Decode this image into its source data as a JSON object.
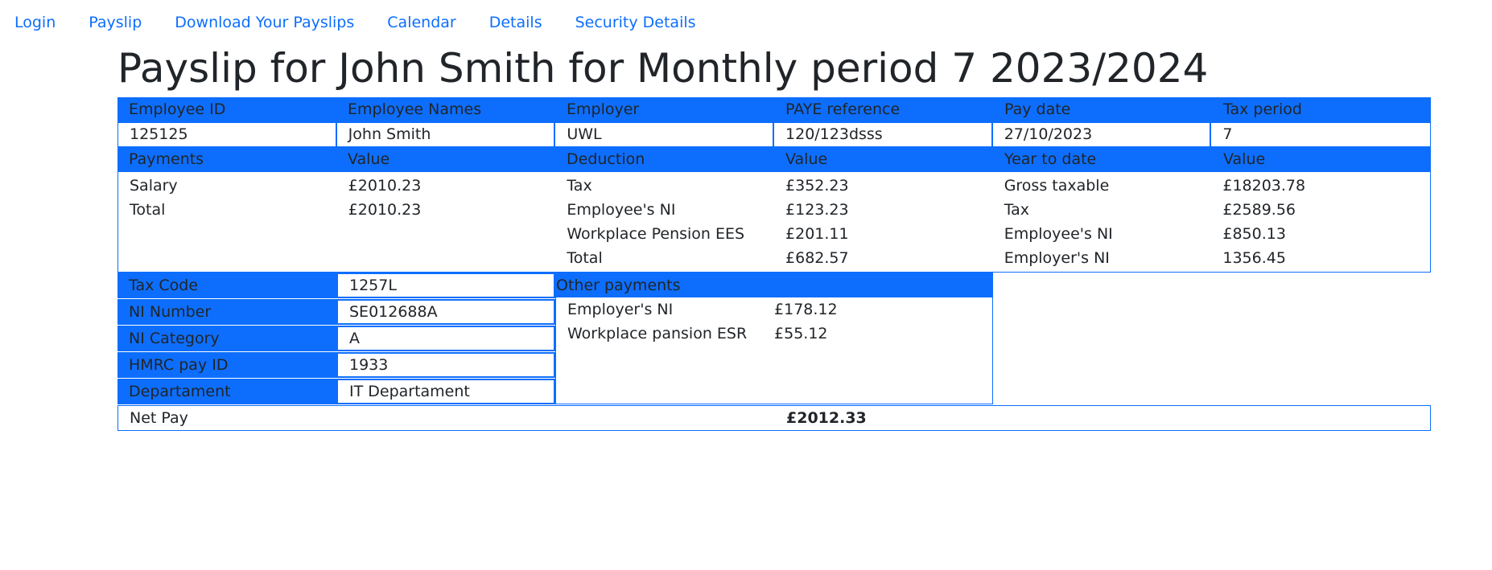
{
  "nav": [
    "Login",
    "Payslip",
    "Download Your Payslips",
    "Calendar",
    "Details",
    "Security Details"
  ],
  "title": "Payslip for John Smith for Monthly period 7 2023/2024",
  "header": {
    "labels": [
      "Employee ID",
      "Employee Names",
      "Employer",
      "PAYE reference",
      "Pay date",
      "Tax period"
    ],
    "values": [
      "125125",
      "John Smith",
      "UWL",
      "120/123dsss",
      "27/10/2023",
      "7"
    ]
  },
  "summary_header": [
    "Payments",
    "Value",
    "Deduction",
    "Value",
    "Year to date",
    "Value"
  ],
  "payments": [
    {
      "name": "Salary",
      "value": "£2010.23"
    },
    {
      "name": "Total",
      "value": "£2010.23"
    }
  ],
  "deductions": [
    {
      "name": "Tax",
      "value": "£352.23"
    },
    {
      "name": "Employee's NI",
      "value": "£123.23"
    },
    {
      "name": "Workplace Pension EES",
      "value": "£201.11"
    },
    {
      "name": "Total",
      "value": "£682.57"
    }
  ],
  "year_to_date": [
    {
      "name": "Gross taxable",
      "value": "£18203.78"
    },
    {
      "name": "Tax",
      "value": "£2589.56"
    },
    {
      "name": "Employee's NI",
      "value": "£850.13"
    },
    {
      "name": "Employer's NI",
      "value": "1356.45"
    }
  ],
  "info": [
    {
      "label": "Tax Code",
      "value": "1257L"
    },
    {
      "label": "NI Number",
      "value": "SE012688A"
    },
    {
      "label": "NI Category",
      "value": "A"
    },
    {
      "label": "HMRC pay ID",
      "value": "1933"
    },
    {
      "label": "Departament",
      "value": "IT Departament"
    }
  ],
  "other_payments": {
    "title": "Other payments",
    "rows": [
      {
        "name": "Employer's NI",
        "value": "£178.12"
      },
      {
        "name": "Workplace pansion ESR",
        "value": "£55.12"
      }
    ]
  },
  "net_pay": {
    "label": "Net Pay",
    "value": "£2012.33"
  },
  "colors": {
    "accent": "#0d6efd",
    "text": "#212529"
  }
}
